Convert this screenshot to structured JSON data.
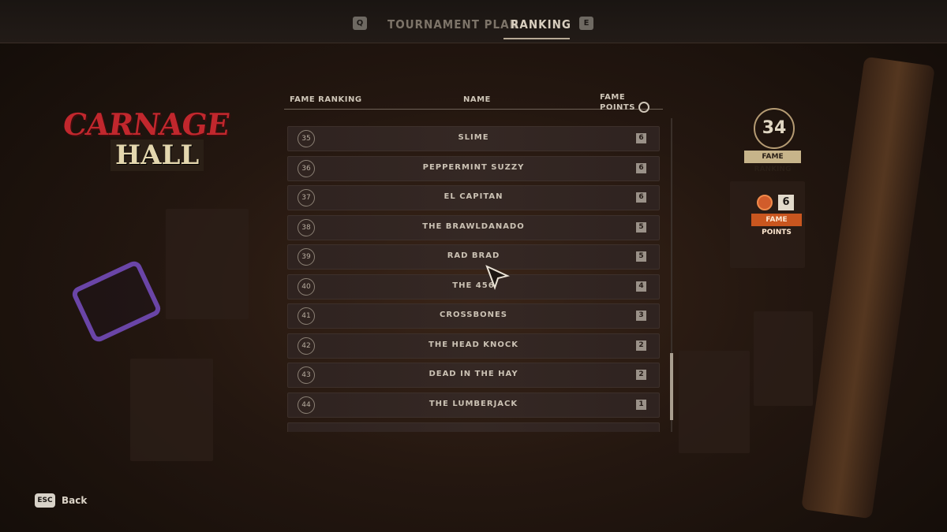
{
  "tabs": {
    "prev_key": "Q",
    "next_key": "E",
    "items": [
      {
        "label": "TOURNAMENT PLAN",
        "active": false
      },
      {
        "label": "RANKING",
        "active": true
      }
    ]
  },
  "logo": {
    "line1": "CARNAGE",
    "line2": "HALL"
  },
  "table": {
    "headers": {
      "rank": "FAME RANKING",
      "name": "NAME",
      "points": "FAME POINTS"
    },
    "rows": [
      {
        "rank": "35",
        "name": "SLIME",
        "points": "6"
      },
      {
        "rank": "36",
        "name": "PEPPERMINT SUZZY",
        "points": "6"
      },
      {
        "rank": "37",
        "name": "EL CAPITAN",
        "points": "6"
      },
      {
        "rank": "38",
        "name": "THE BRAWLDANADO",
        "points": "5"
      },
      {
        "rank": "39",
        "name": "RAD BRAD",
        "points": "5"
      },
      {
        "rank": "40",
        "name": "THE 456",
        "points": "4"
      },
      {
        "rank": "41",
        "name": "CROSSBONES",
        "points": "3"
      },
      {
        "rank": "42",
        "name": "THE HEAD KNOCK",
        "points": "2"
      },
      {
        "rank": "43",
        "name": "DEAD IN THE HAY",
        "points": "2"
      },
      {
        "rank": "44",
        "name": "THE LUMBERJACK",
        "points": "1"
      }
    ]
  },
  "player": {
    "fame_ranking_value": "34",
    "fame_ranking_label": "FAME RANKING",
    "fame_points_value": "6",
    "fame_points_label": "FAME POINTS"
  },
  "footer": {
    "back_key": "ESC",
    "back_label": "Back"
  },
  "colors": {
    "accent": "#c9561f",
    "logo_red": "#c1272d",
    "brass_purple": "#6a45a7"
  }
}
